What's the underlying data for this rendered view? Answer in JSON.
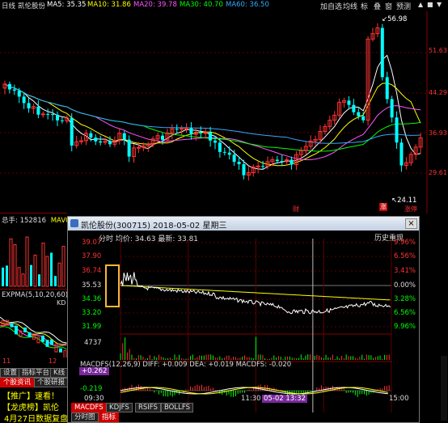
{
  "top_bar": {
    "period": "日线",
    "stock_name": "凯伦股份",
    "ma5": "MA5: 35.35",
    "ma10": "MA10: 31.86",
    "ma20": "MA20: 39.78",
    "ma30": "MA30: 40.70",
    "ma60": "MA60: 36.50"
  },
  "toolbar": {
    "add_self": "加自选",
    "equal_line": "均线",
    "scale": "标",
    "overlay": "叠",
    "window": "窗",
    "forecast": "预测"
  },
  "daily_chart": {
    "price_axis": [
      "51.63",
      "44.29",
      "36.93",
      "29.61"
    ],
    "high_label": "56.98",
    "low_label": "24.11",
    "markers": [
      "财",
      "涨",
      "停"
    ],
    "colors": {
      "up": "#ff3333",
      "down": "#00ffff"
    }
  },
  "volume_panel": {
    "label": "总手: 152816",
    "mavol": "MAVO"
  },
  "expma": {
    "label": "EXPMA(5,10,20,60)",
    "kd": "KD"
  },
  "left_tabs": [
    "设置",
    "指标平台",
    "K线"
  ],
  "left_numbers": [
    "11",
    "12"
  ],
  "news": {
    "tabs": [
      "个股资讯",
      "个股研报"
    ],
    "items": [
      "【推广】速看！",
      "【龙虎榜】凯伦",
      "4月27日数据复盘"
    ]
  },
  "popup": {
    "title": "凯伦股份(300715)  2018-05-02 星期三",
    "close": "×",
    "info": "分时 均价: 34.63 最新: 33.81",
    "history_button": "历史重现",
    "left_axis": [
      "39.07",
      "37.90",
      "36.74",
      "35.53",
      "34.36",
      "33.20",
      "31.99",
      "4737"
    ],
    "right_axis": [
      "9.96%",
      "6.56%",
      "3.41%",
      "0.00%",
      "3.28%",
      "6.56%",
      "9.96%"
    ],
    "macd_label": "MACDFS(12,26,9)  DIFF: +0.009  DEA: +0.019  MACDFS: -0.020",
    "macd_value": "+0.262",
    "macd_low": "-0.219",
    "time_labels": [
      "09:30",
      "11:30",
      "15:00"
    ],
    "cursor_time": "05-02 13:32",
    "indicator_tabs": [
      "MACDFS",
      "KDJFS",
      "RSIFS",
      "BOLLFS"
    ],
    "bottom_tabs": [
      "分时图",
      "指标"
    ]
  }
}
